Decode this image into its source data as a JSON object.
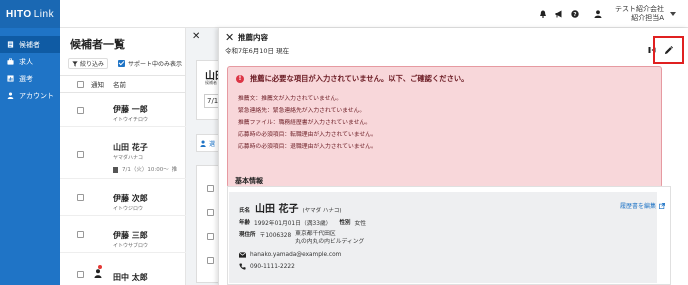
{
  "app": {
    "logo_main": "HITO",
    "logo_sub": "Link"
  },
  "sidebar": {
    "items": [
      {
        "label": "候補者",
        "icon": "document-icon",
        "active": true
      },
      {
        "label": "求人",
        "icon": "briefcase-icon",
        "active": false
      },
      {
        "label": "選考",
        "icon": "chart-icon",
        "active": false
      },
      {
        "label": "アカウント",
        "icon": "person-icon",
        "active": false
      }
    ]
  },
  "header": {
    "company": "テスト紹介会社",
    "user": "紹介担当A",
    "icons": [
      "bell-icon",
      "megaphone-icon",
      "help-icon",
      "user-icon"
    ]
  },
  "list": {
    "title": "候補者一覧",
    "filter_label": "絞り込み",
    "support_label": "サポート中のみ表示",
    "col_notify": "通知",
    "col_name": "名前",
    "rows": [
      {
        "name": "伊藤 一郎",
        "kana": "イトウイチロウ"
      },
      {
        "name": "山田 花子",
        "kana": "ヤマダハナコ",
        "doc": "7/1（火）10:00〜",
        "doc_extra": "推"
      },
      {
        "name": "伊藤 次郎",
        "kana": "イトウジロウ"
      },
      {
        "name": "伊藤 三郎",
        "kana": "イトウサブロウ"
      },
      {
        "name": "田中 太郎",
        "kana": ""
      }
    ]
  },
  "bg": {
    "name": "山田",
    "sub": "候補者 ID",
    "box": "7/1",
    "tab": "選"
  },
  "drawer": {
    "title": "推薦内容",
    "date": "令和7年6月10日 現在",
    "alert": {
      "heading": "推薦に必要な項目が入力されていません。以下、ご確認ください。",
      "items": [
        "推薦文：推薦文が入力されていません。",
        "緊急連絡先：緊急連絡先が入力されていません。",
        "推薦ファイル：職務経歴書が入力されていません。",
        "応募時の必須項目：転職理由が入力されていません。",
        "応募時の必須項目：退職理由が入力されていません。"
      ]
    },
    "basic": {
      "title": "基本情報",
      "name_label": "氏名",
      "name": "山田 花子",
      "kana": "(ヤマダ ハナコ)",
      "edit_link": "履歴書を編集",
      "birth_label": "年齢",
      "birth": "1992年01月01日（満33歳）",
      "gender_label": "性別",
      "gender": "女性",
      "address_label": "現住所",
      "postal": "〒1006328",
      "address_line1": "東京都千代田区",
      "address_line2": "丸の内丸の内ビルディング",
      "email": "hanako.yamada@example.com",
      "phone": "090-1111-2222"
    }
  }
}
